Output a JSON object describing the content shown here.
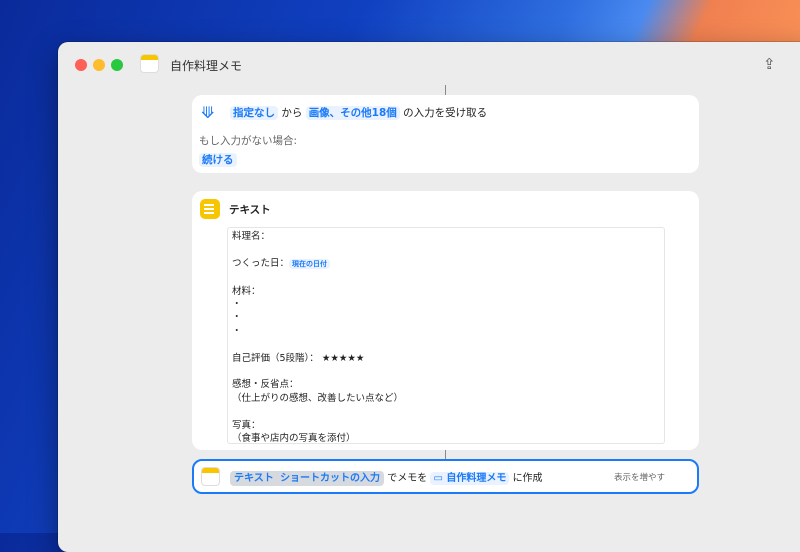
{
  "window": {
    "title": "自作料理メモ"
  },
  "receive": {
    "source": "指定なし",
    "from": "から",
    "types": "画像、その他18個",
    "suffix": "の入力を受け取る",
    "no_input_label": "もし入力がない場合:",
    "no_input_action": "続ける"
  },
  "text_action": {
    "title": "テキスト",
    "lines": {
      "dish": "料理名：",
      "date_label": "つくった日：",
      "date_var": "現在の日付",
      "ingredients": "材料：",
      "bullet": "・",
      "rating": "自己評価（5段階）：",
      "stars": "★★★★★",
      "reflection": "感想・反省点：",
      "reflection_hint": "（仕上がりの感想、改善したい点など）",
      "photo": "写真：",
      "photo_hint": "（食事や店内の写真を添付）"
    }
  },
  "create_note": {
    "var_text": "テキスト",
    "var_input": "ショートカットの入力",
    "mid": "でメモを",
    "folder": "自作料理メモ",
    "suffix": "に作成",
    "more": "表示を増やす"
  }
}
